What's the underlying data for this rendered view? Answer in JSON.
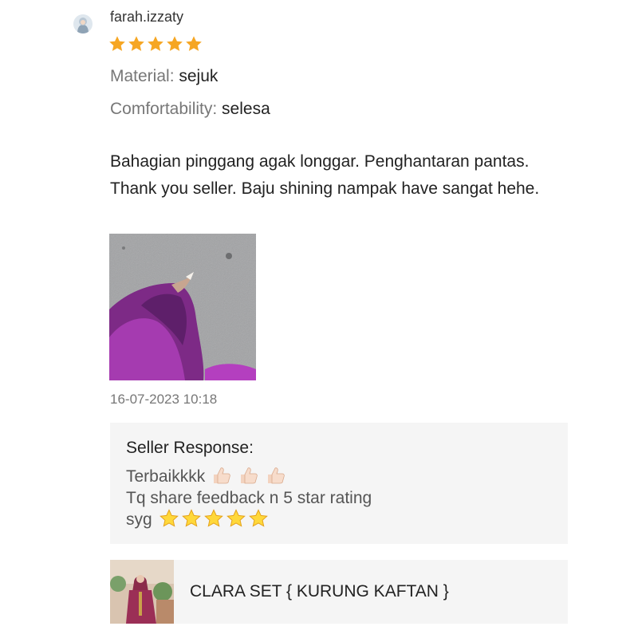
{
  "review": {
    "username": "farah.izzaty",
    "rating": 5,
    "attributes": [
      {
        "label": "Material:",
        "value": "sejuk"
      },
      {
        "label": "Comfortability:",
        "value": "selesa"
      }
    ],
    "text": "Bahagian pinggang agak longgar. Penghantaran pantas. Thank you seller. Baju shining nampak have sangat hehe.",
    "timestamp": "16-07-2023 10:18",
    "star_color": "#f6a623"
  },
  "seller_response": {
    "title": "Seller Response:",
    "line1": "Terbaikkkk",
    "line1_emoji": "thumbs-up-icon",
    "line1_emoji_count": 3,
    "line2": "Tq share feedback n 5 star rating",
    "line3": "syg",
    "line3_emoji": "star-emoji-icon",
    "line3_emoji_count": 5
  },
  "product": {
    "name": "CLARA SET { KURUNG KAFTAN }"
  }
}
